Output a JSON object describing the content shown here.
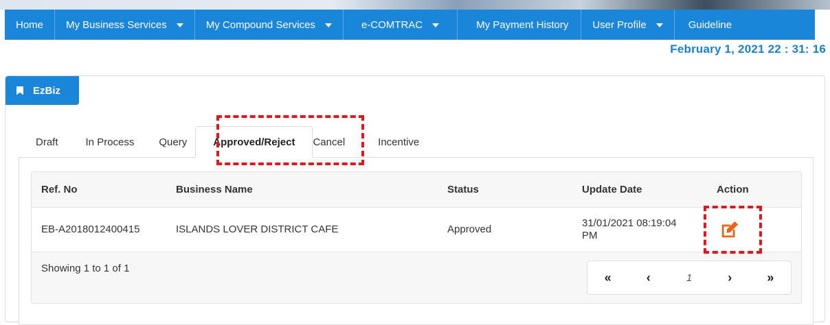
{
  "nav": {
    "items": [
      {
        "label": "Home",
        "dropdown": false
      },
      {
        "label": "My Business Services",
        "dropdown": true
      },
      {
        "label": "My Compound Services",
        "dropdown": true
      },
      {
        "label": "e-COMTRAC",
        "dropdown": true
      },
      {
        "label": "My Payment History",
        "dropdown": false
      },
      {
        "label": "User Profile",
        "dropdown": true
      },
      {
        "label": "Guideline",
        "dropdown": false
      }
    ]
  },
  "clock": "February 1, 2021 22 : 31: 16",
  "panel": {
    "title": "EzBiz",
    "icon": "bookmark-icon"
  },
  "tabs": [
    "Draft",
    "In Process",
    "Query",
    "Approved/Reject",
    "Cancel",
    "Incentive"
  ],
  "active_tab": "Approved/Reject",
  "table": {
    "headers": [
      "Ref. No",
      "Business Name",
      "Status",
      "Update Date",
      "Action"
    ],
    "rows": [
      {
        "ref_no": "EB-A2018012400415",
        "business_name": "ISLANDS LOVER DISTRICT CAFE",
        "status": "Approved",
        "update_date_line1": "31/01/2021 08:19:04",
        "update_date_line2": "PM",
        "action_icon": "edit-icon"
      }
    ],
    "showing": "Showing 1 to 1 of 1"
  },
  "pagination": {
    "first": "«",
    "prev": "‹",
    "current": "1",
    "next": "›",
    "last": "»"
  },
  "colors": {
    "nav_bg": "#1a86d9",
    "clock": "#1a7fd1",
    "edit_icon": "#e8661c",
    "highlight": "#e2161c"
  }
}
